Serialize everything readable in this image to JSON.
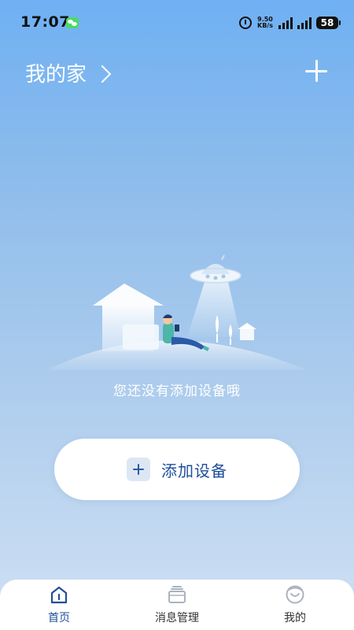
{
  "status_bar": {
    "time": "17:07",
    "net_speed_value": "9.50",
    "net_speed_unit": "KB/s",
    "battery": "58"
  },
  "header": {
    "home_name": "我的家"
  },
  "empty_state": {
    "message": "您还没有添加设备哦"
  },
  "add_device": {
    "label": "添加设备"
  },
  "bottom_nav": {
    "items": [
      {
        "label": "首页",
        "icon": "home-icon",
        "active": true
      },
      {
        "label": "消息管理",
        "icon": "message-icon",
        "active": false
      },
      {
        "label": "我的",
        "icon": "profile-icon",
        "active": false
      }
    ]
  },
  "colors": {
    "accent": "#1f4f9a",
    "bg_top": "#6fb0f3",
    "bg_bottom": "#cfe0f4"
  }
}
